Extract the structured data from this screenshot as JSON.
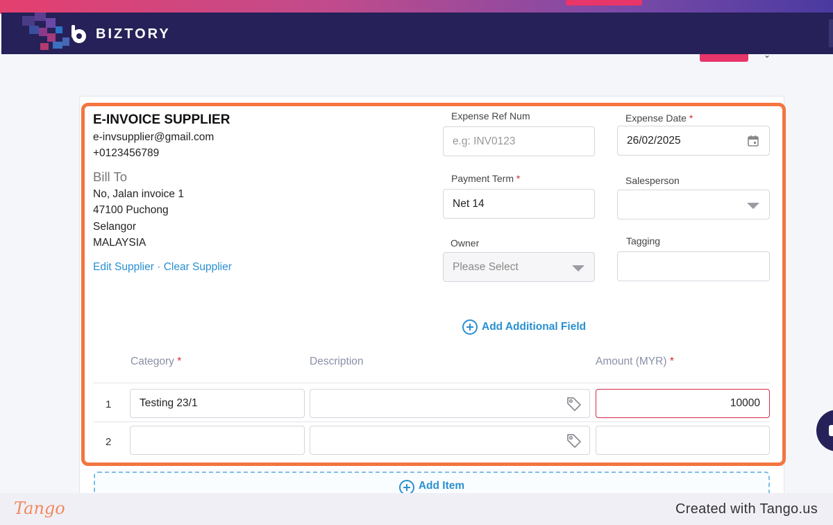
{
  "app": {
    "brand": "BIZTORY"
  },
  "supplier": {
    "name": "E-INVOICE SUPPLIER",
    "email": "e-invsupplier@gmail.com",
    "phone": "+0123456789",
    "bill_to_label": "Bill To",
    "address": [
      "No, Jalan invoice 1",
      "47100 Puchong",
      "Selangor",
      "MALAYSIA"
    ],
    "edit_link": "Edit Supplier",
    "separator": "·",
    "clear_link": "Clear Supplier"
  },
  "fields": {
    "expense_ref": {
      "label": "Expense Ref Num",
      "placeholder": "e.g: INV0123",
      "value": ""
    },
    "expense_date": {
      "label": "Expense Date",
      "required": "*",
      "value": "26/02/2025"
    },
    "payment_term": {
      "label": "Payment Term",
      "required": "*",
      "value": "Net 14"
    },
    "salesperson": {
      "label": "Salesperson",
      "value": ""
    },
    "owner": {
      "label": "Owner",
      "placeholder": "Please Select"
    },
    "tagging": {
      "label": "Tagging",
      "value": ""
    }
  },
  "add_field_label": "Add Additional Field",
  "items_table": {
    "columns": [
      {
        "label": "Category",
        "required": "*"
      },
      {
        "label": "Description",
        "required": ""
      },
      {
        "label": "Amount (MYR)",
        "required": "*"
      }
    ],
    "rows": [
      {
        "num": "1",
        "category": "Testing 23/1",
        "description": "",
        "amount": "10000"
      },
      {
        "num": "2",
        "category": "",
        "description": "",
        "amount": ""
      }
    ]
  },
  "add_item_label": "Add Item",
  "footer": {
    "brand": "Tango",
    "created_with": "Created with Tango.us"
  },
  "colors": {
    "accent": "#2a8fd0",
    "highlight": "#f47540",
    "header": "#262158",
    "error": "#d42a4a"
  }
}
